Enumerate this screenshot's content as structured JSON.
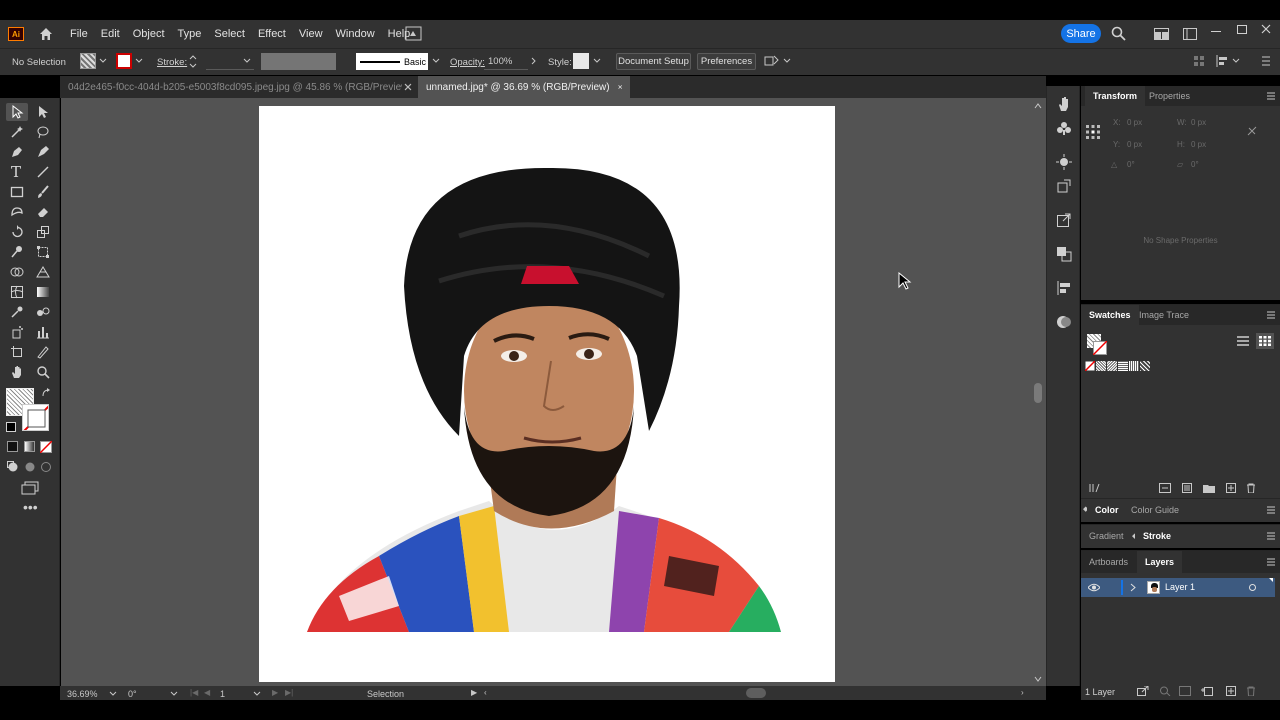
{
  "app": {
    "logo": "Ai",
    "share_label": "Share"
  },
  "menu": [
    "File",
    "Edit",
    "Object",
    "Type",
    "Select",
    "Effect",
    "View",
    "Window",
    "Help"
  ],
  "control_bar": {
    "selection_label": "No Selection",
    "stroke_label": "Stroke:",
    "brush_label": "Basic",
    "opacity_label": "Opacity:",
    "opacity_value": "100%",
    "style_label": "Style:",
    "document_setup_label": "Document Setup",
    "preferences_label": "Preferences"
  },
  "tabs": [
    {
      "label": "04d2e465-f0cc-404d-b205-e5003f8cd095.jpeg.jpg @ 45.86 % (RGB/Preview)",
      "active": false
    },
    {
      "label": "unnamed.jpg* @ 36.69 % (RGB/Preview)",
      "active": true
    }
  ],
  "transform_panel": {
    "tabs": [
      "Transform",
      "Properties"
    ],
    "x_label": "X:",
    "x_value": "0 px",
    "y_label": "Y:",
    "y_value": "0 px",
    "w_label": "W:",
    "w_value": "0 px",
    "h_label": "H:",
    "h_value": "0 px",
    "angle_value": "0°",
    "shear_value": "0°",
    "empty_message": "No Shape Properties"
  },
  "swatches_panel": {
    "tabs": [
      "Swatches",
      "Image Trace"
    ]
  },
  "color_panel": {
    "tabs": [
      "Color",
      "Color Guide"
    ]
  },
  "gradient_panel": {
    "tabs": [
      "Gradient",
      "Stroke"
    ]
  },
  "layers_panel": {
    "tabs": [
      "Artboards",
      "Layers"
    ],
    "layers": [
      {
        "name": "Layer 1"
      }
    ],
    "footer_count": "1 Layer"
  },
  "status": {
    "zoom": "36.69%",
    "rotation": "0°",
    "artboard_number": "1",
    "tool_name": "Selection"
  },
  "colors": {
    "accent": "#1473e6",
    "app_bg": "#323232",
    "canvas_bg": "#535353",
    "turban": "#141414",
    "turban_band": "#c8102e"
  }
}
